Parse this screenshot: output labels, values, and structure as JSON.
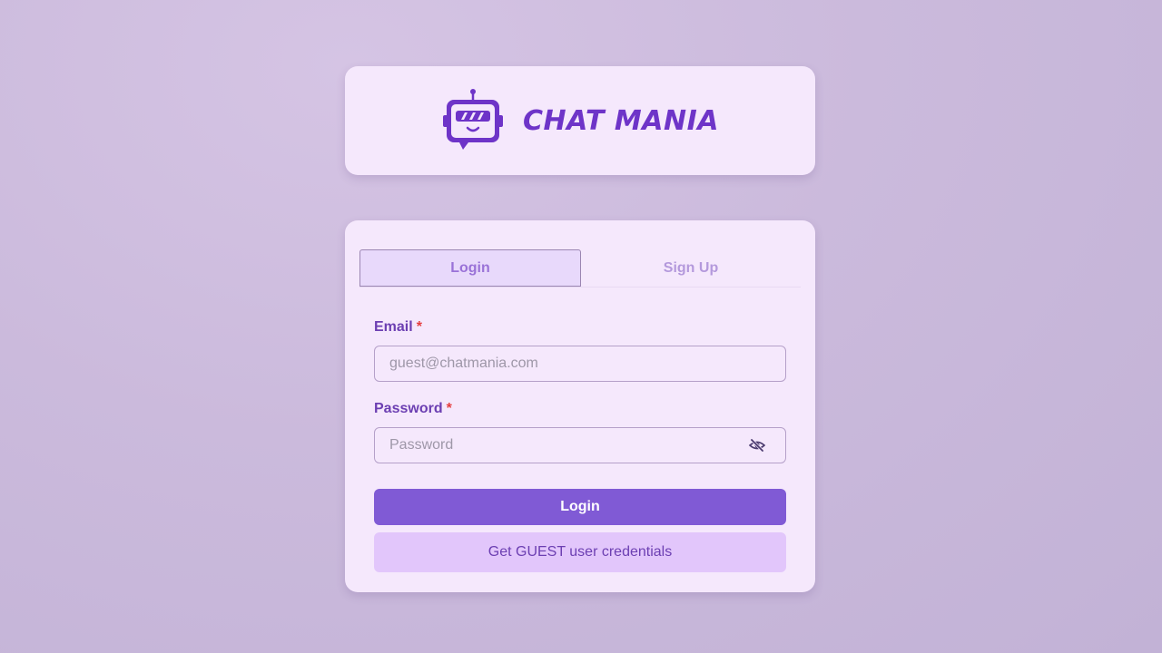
{
  "brand": {
    "title": "CHAT MANIA",
    "icon": "robot-chat-icon",
    "color": "#6e34c8"
  },
  "tabs": [
    {
      "label": "Login",
      "active": true
    },
    {
      "label": "Sign Up",
      "active": false
    }
  ],
  "form": {
    "email": {
      "label": "Email",
      "required_marker": "*",
      "placeholder": "guest@chatmania.com",
      "value": ""
    },
    "password": {
      "label": "Password",
      "required_marker": "*",
      "placeholder": "Password",
      "value": "",
      "toggle_icon": "eye-slash-icon"
    },
    "submit_label": "Login",
    "guest_label": "Get GUEST user credentials"
  },
  "colors": {
    "accent": "#805ad5",
    "required": "#e53e3e",
    "card_bg": "#f5e8fc",
    "guest_bg": "#e2c6fb"
  }
}
